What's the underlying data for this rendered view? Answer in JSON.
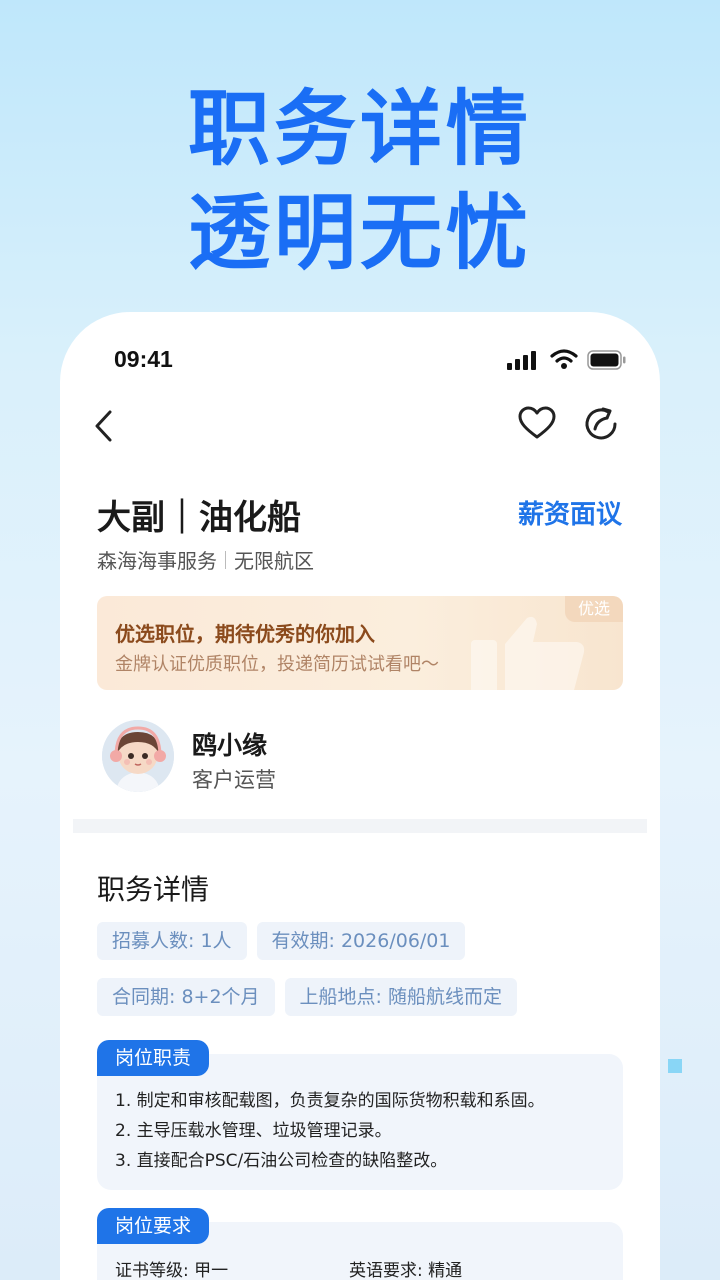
{
  "hero": {
    "line1": "职务详情",
    "line2": "透明无忧"
  },
  "status_bar": {
    "time": "09:41"
  },
  "icons": {
    "back": "chevron-left-icon",
    "favorite": "heart-icon",
    "share": "share-icon",
    "signal": "signal-icon",
    "wifi": "wifi-icon",
    "battery": "battery-icon"
  },
  "job": {
    "title": "大副｜油化船",
    "salary": "薪资面议",
    "company": "森海海事服务",
    "area": "无限航区"
  },
  "banner": {
    "title": "优选职位，期待优秀的你加入",
    "subtitle": "金牌认证优质职位，投递简历试试看吧～",
    "tag": "优选"
  },
  "contact": {
    "name": "鸥小缘",
    "role": "客户运营"
  },
  "details": {
    "title": "职务详情",
    "tags": [
      "招募人数: 1人",
      "有效期: 2026/06/01",
      "合同期: 8+2个月",
      "上船地点: 随船航线而定"
    ]
  },
  "duties": {
    "label": "岗位职责",
    "items": [
      "1. 制定和审核配载图，负责复杂的国际货物积载和系固。",
      "2. 主导压载水管理、垃圾管理记录。",
      "3. 直接配合PSC/石油公司检查的缺陷整改。"
    ]
  },
  "requirements": {
    "label": "岗位要求",
    "cert": "证书等级: 甲一",
    "english": "英语要求: 精通"
  },
  "colors": {
    "accent": "#1f74e8",
    "hero": "#1a6ef5"
  }
}
